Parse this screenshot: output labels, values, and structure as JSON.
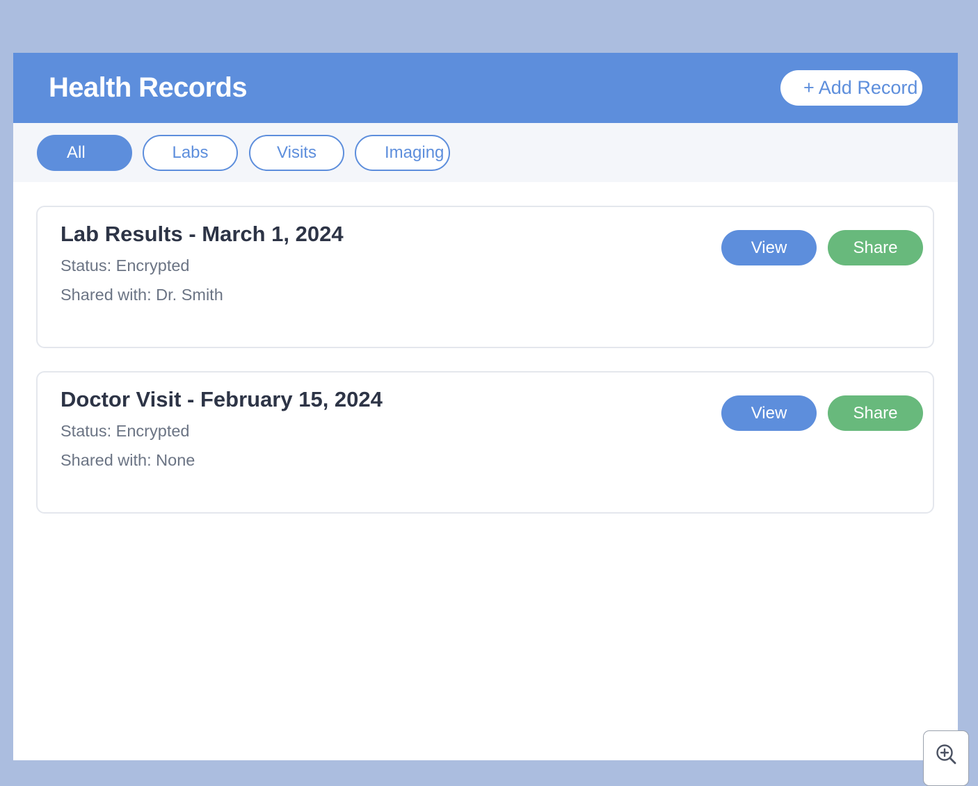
{
  "header": {
    "title": "Health Records",
    "add_record_label": "+ Add Record"
  },
  "filters": [
    {
      "label": "All",
      "active": true
    },
    {
      "label": "Labs",
      "active": false
    },
    {
      "label": "Visits",
      "active": false
    },
    {
      "label": "Imaging",
      "active": false
    }
  ],
  "records": [
    {
      "title": "Lab Results - March 1, 2024",
      "status": "Status: Encrypted",
      "shared": "Shared with: Dr. Smith",
      "view_label": "View",
      "share_label": "Share"
    },
    {
      "title": "Doctor Visit - February 15, 2024",
      "status": "Status: Encrypted",
      "shared": "Shared with: None",
      "view_label": "View",
      "share_label": "Share"
    }
  ],
  "zoom": {
    "icon": "zoom-in-icon"
  },
  "colors": {
    "page_background": "#abbddf",
    "primary": "#5d8edc",
    "share": "#68b97c",
    "title_text": "#2d3446",
    "meta_text": "#6b7484",
    "filter_bar": "#f4f6fa"
  }
}
